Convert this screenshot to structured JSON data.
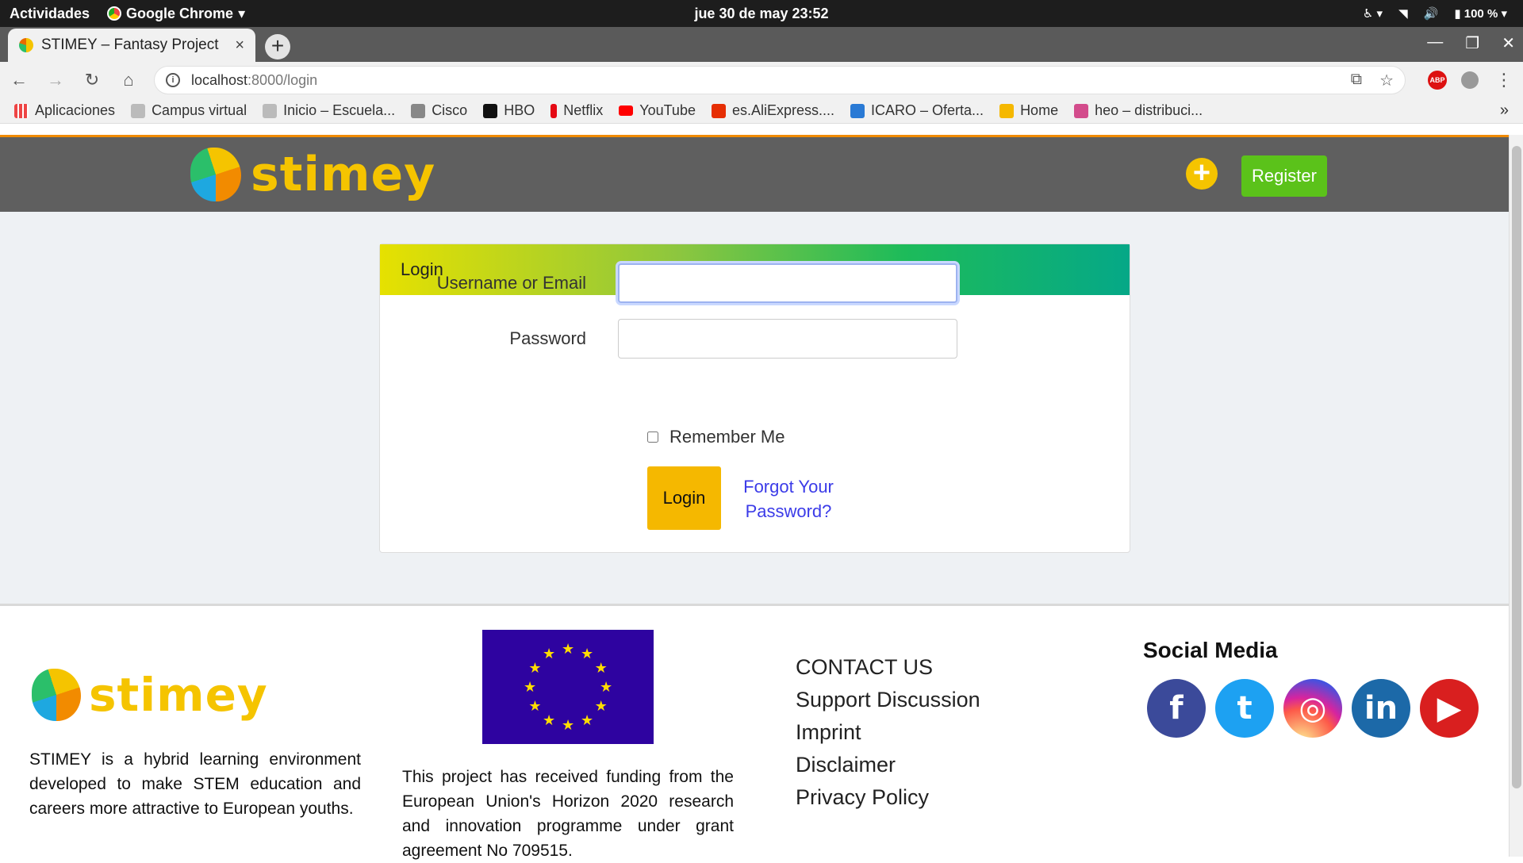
{
  "os": {
    "activities": "Actividades",
    "app_name": "Google Chrome",
    "clock": "jue 30 de may  23:52",
    "battery": "100 %"
  },
  "browser": {
    "tab_title": "STIMEY – Fantasy Project",
    "url_host": "localhost",
    "url_rest": ":8000/login",
    "bookmarks": [
      "Aplicaciones",
      "Campus virtual",
      "Inicio – Escuela...",
      "Cisco",
      "HBO",
      "Netflix",
      "YouTube",
      "es.AliExpress....",
      "ICARO – Oferta...",
      "Home",
      "heo – distribuci..."
    ],
    "more": "»"
  },
  "header": {
    "logo_text": "stimey",
    "register_label": "Register",
    "plus_icon": "+"
  },
  "login": {
    "title": "Login",
    "username_label": "Username or Email",
    "username_value": "",
    "password_label": "Password",
    "password_value": "",
    "remember_label": "Remember Me",
    "login_button": "Login",
    "forgot_line1": "Forgot Your",
    "forgot_line2": "Password?"
  },
  "footer": {
    "logo_text": "stimey",
    "about": "STIMEY is a hybrid learning environment developed to make STEM education and careers more attractive to European youths.",
    "funding": "This project has received funding from the European Union's Horizon 2020 research and innovation programme under grant agreement No 709515.",
    "links": [
      "CONTACT US",
      "Support Discussion",
      "Imprint",
      "Disclaimer",
      "Privacy Policy"
    ],
    "social_title": "Social Media",
    "social": [
      {
        "name": "facebook",
        "glyph": "f",
        "color": "#3b4a9a"
      },
      {
        "name": "twitter",
        "glyph": "t",
        "color": "#1da1f2"
      },
      {
        "name": "instagram",
        "glyph": "◎",
        "color": "#c13584"
      },
      {
        "name": "linkedin",
        "glyph": "in",
        "color": "#1c69a8"
      },
      {
        "name": "youtube",
        "glyph": "▶",
        "color": "#d91f1f"
      }
    ]
  }
}
